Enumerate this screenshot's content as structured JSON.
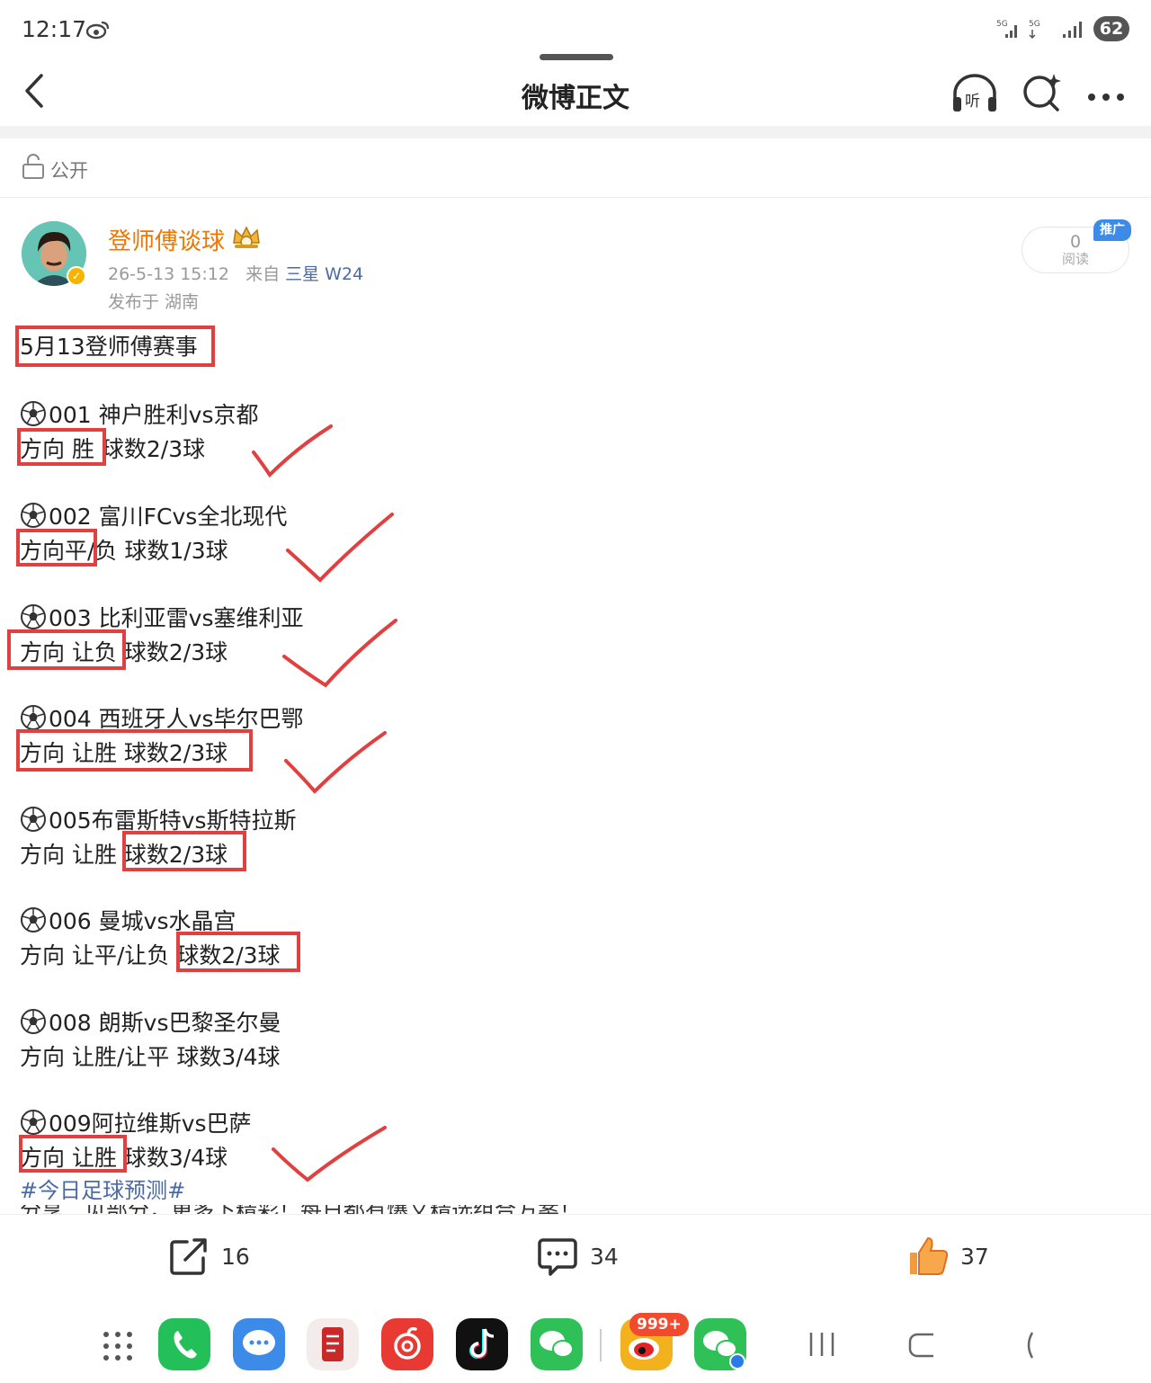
{
  "status": {
    "time": "12:17",
    "net1": "5G",
    "net2": "5G",
    "battery": "62"
  },
  "nav": {
    "title": "微博正文"
  },
  "visibility": {
    "label": "公开"
  },
  "author": {
    "name": "登师傅谈球",
    "timestamp": "26-5-13 15:12",
    "source_prefix": "来自",
    "device": "三星 W24",
    "location": "发布于 湖南",
    "read_count": "0",
    "read_label": "阅读",
    "promo_tag": "推广"
  },
  "post": {
    "title": "5月13登师傅赛事",
    "matches": [
      {
        "match": "001 神户胜利vs京都",
        "pick": "方向 胜  球数2/3球"
      },
      {
        "match": "002 富川FCvs全北现代",
        "pick": "方向平/负 球数1/3球"
      },
      {
        "match": "003 比利亚雷vs塞维利亚",
        "pick": "方向 让负 球数2/3球"
      },
      {
        "match": "004 西班牙人vs毕尔巴鄂",
        "pick": "方向 让胜 球数2/3球"
      },
      {
        "match": "005布雷斯特vs斯特拉斯",
        "pick": "方向 让胜 球数2/3球"
      },
      {
        "match": "006 曼城vs水晶宫",
        "pick": "方向 让平/让负 球数2/3球"
      },
      {
        "match": "008 朗斯vs巴黎圣尔曼",
        "pick": "方向 让胜/让平 球数3/4球"
      },
      {
        "match": "009阿拉维斯vs巴萨",
        "pick": "方向 让胜 球数3/4球"
      }
    ],
    "hashtag": "#今日足球预测#",
    "cut_text": "分享二见部分，更多下精彩！每日都有爆文精选组合方案！"
  },
  "actions": {
    "repost": "16",
    "comment": "34",
    "like": "37"
  },
  "dock": {
    "weibo_badge": "999+"
  },
  "colors": {
    "accent": "#ee7700",
    "link": "#4a6aa5",
    "highlight": "#e04040"
  }
}
